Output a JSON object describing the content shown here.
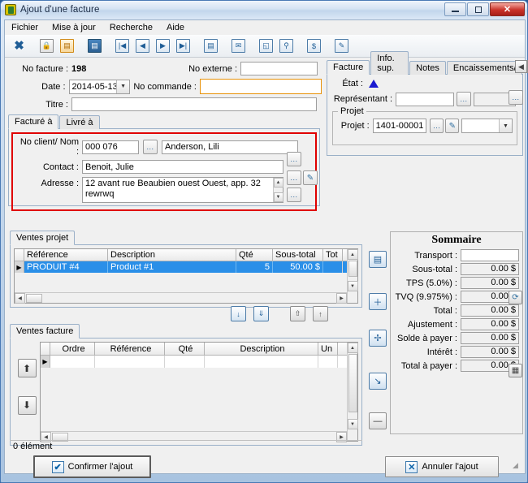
{
  "window": {
    "title": "Ajout d'une facture",
    "icon": "app-icon",
    "buttons": {
      "minimize": "–",
      "maximize": "□",
      "close": "✕"
    }
  },
  "menu": [
    "Fichier",
    "Mise à jour",
    "Recherche",
    "Aide"
  ],
  "toolbar": [
    {
      "name": "close-icon",
      "glyph": "✖"
    },
    {
      "name": "lock-icon",
      "glyph": "🔒"
    },
    {
      "name": "save-orange-icon",
      "glyph": "▤"
    },
    {
      "name": "save-icon",
      "glyph": "▤"
    },
    {
      "name": "first-record-icon",
      "glyph": "|◀"
    },
    {
      "name": "previous-record-icon",
      "glyph": "◀"
    },
    {
      "name": "next-record-icon",
      "glyph": "▶"
    },
    {
      "name": "last-record-icon",
      "glyph": "▶|"
    },
    {
      "name": "report-icon",
      "glyph": "▤"
    },
    {
      "name": "email-icon",
      "glyph": "✉"
    },
    {
      "name": "print-preview-icon",
      "glyph": "◱"
    },
    {
      "name": "attach-icon",
      "glyph": "⚲"
    },
    {
      "name": "payment-icon",
      "glyph": "$"
    },
    {
      "name": "edit-note-icon",
      "glyph": "✎"
    }
  ],
  "invoice": {
    "no_facture_label": "No facture :",
    "no_facture_value": "198",
    "no_externe_label": "No externe :",
    "no_externe_value": "",
    "date_label": "Date :",
    "date_value": "2014-05-13",
    "no_commande_label": "No commande :",
    "no_commande_value": "",
    "titre_label": "Titre :",
    "titre_value": ""
  },
  "address_tabs": [
    {
      "label": "Facturé à",
      "active": true
    },
    {
      "label": "Livré à",
      "active": false
    }
  ],
  "client": {
    "no_client_label": "No client/ Nom :",
    "no_client_value": "000 076",
    "client_name_value": "Anderson, Lili",
    "contact_label": "Contact :",
    "contact_value": "Benoit, Julie",
    "adresse_label": "Adresse :",
    "adresse_value": "12 avant rue Beaubien ouest Ouest, app. 32\nrewrwq",
    "adresse_line1": "12 avant rue Beaubien ouest Ouest, app. 32",
    "adresse_line2": "rewrwq",
    "ellipsis": "..."
  },
  "right_tabs": [
    {
      "label": "Facture",
      "active": true
    },
    {
      "label": "Info. sup.",
      "active": false
    },
    {
      "label": "Notes",
      "active": false
    },
    {
      "label": "Encaissements/Rembo",
      "active": false
    }
  ],
  "facture_tab": {
    "etat_label": "État :",
    "etat_icon": "triangle-up-icon",
    "representant_label": "Représentant :",
    "representant_value": "",
    "representant_value2": "",
    "projet_group_label": "Projet",
    "projet_label": "Projet :",
    "projet_value": "1401-00001",
    "projet_combo_value": ""
  },
  "ventes_projet": {
    "tab_label": "Ventes projet",
    "columns": [
      "",
      "Référence",
      "Description",
      "Qté",
      "Sous-total",
      "Tot"
    ],
    "rows": [
      {
        "marker": "▶",
        "reference": "PRODUIT #4",
        "description": "Product #1",
        "qte": "5",
        "sous_total": "50.00 $",
        "tot": "",
        "selected": true
      }
    ]
  },
  "transfer_buttons": [
    {
      "name": "move-down-single-button",
      "glyph": "↓"
    },
    {
      "name": "move-down-all-button",
      "glyph": "⇓"
    },
    {
      "name": "move-up-all-button",
      "glyph": "⇧"
    },
    {
      "name": "move-up-single-button",
      "glyph": "↑"
    }
  ],
  "ventes_facture": {
    "tab_label": "Ventes facture",
    "columns": [
      "",
      "",
      "Ordre",
      "Référence",
      "Qté",
      "Description",
      "Un"
    ],
    "rows": [
      {
        "marker": "▶",
        "ordre": "",
        "reference": "",
        "qte": "",
        "description": "",
        "un": ""
      }
    ],
    "reorder_up": "⬆",
    "reorder_down": "⬇",
    "status": "0 élément"
  },
  "side_buttons": [
    {
      "name": "insert-line-button",
      "glyph": "▤"
    },
    {
      "name": "add-button",
      "glyph": "＋"
    },
    {
      "name": "add-multiple-button",
      "glyph": "✢"
    },
    {
      "name": "special-action-button",
      "glyph": "↘"
    },
    {
      "name": "remove-button",
      "glyph": "—"
    }
  ],
  "summary": {
    "title": "Sommaire",
    "rows": [
      {
        "label": "Transport :",
        "value": "",
        "editable": true
      },
      {
        "label": "Sous-total :",
        "value": "0.00 $",
        "editable": false
      },
      {
        "label": "TPS (5.0%) :",
        "value": "0.00 $",
        "editable": false
      },
      {
        "label": "TVQ (9.975%) :",
        "value": "0.00 $",
        "editable": false
      },
      {
        "label": "Total :",
        "value": "0.00 $",
        "editable": false
      },
      {
        "label": "Ajustement :",
        "value": "0.00 $",
        "editable": false
      },
      {
        "label": "Solde à payer :",
        "value": "0.00 $",
        "editable": false
      },
      {
        "label": "Intérêt :",
        "value": "0.00 $",
        "editable": false
      },
      {
        "label": "Total à payer :",
        "value": "0.00 $",
        "editable": false
      }
    ],
    "refresh_icon": "refresh-icon",
    "table_icon": "table-icon"
  },
  "footer": {
    "confirm_label": "Confirmer l'ajout",
    "confirm_icon": "checkmark-icon",
    "cancel_label": "Annuler l'ajout",
    "cancel_icon": "cross-icon"
  },
  "colors": {
    "accent": "#2a8fe8",
    "highlight_border": "#e00000",
    "focus_border": "#e8920a",
    "titlebar": "#d5e3f3",
    "close_button": "#c9332a"
  }
}
